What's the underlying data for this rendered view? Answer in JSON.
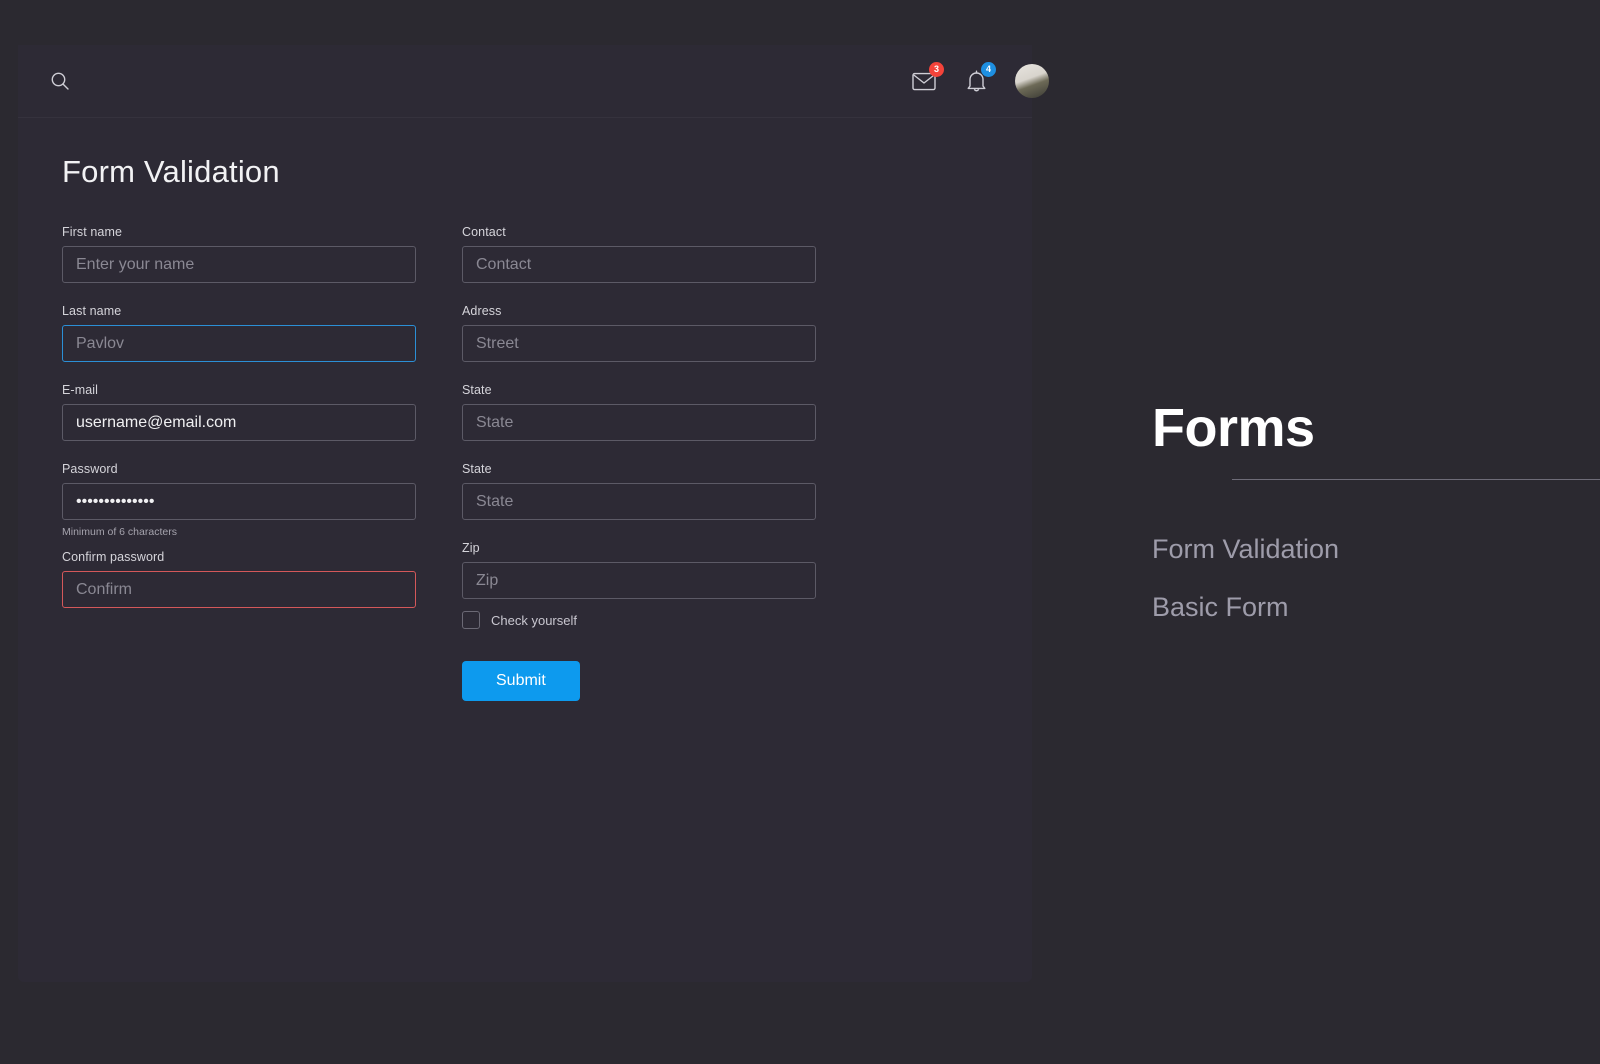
{
  "theme": {
    "page_bg": "#2b2930",
    "panel_bg": "#2d2a35",
    "accent_blue": "#0d9aee",
    "focus_blue": "#2b8fd6",
    "error_red": "#d4585a",
    "badge_red": "#f4433a",
    "badge_blue": "#1e8fe1"
  },
  "header": {
    "search_icon": "search-icon",
    "mail_icon": "mail-icon",
    "mail_badge": "3",
    "bell_icon": "bell-icon",
    "bell_badge": "4",
    "avatar_icon": "avatar"
  },
  "main": {
    "title": "Form Validation",
    "left_fields": [
      {
        "label": "First name",
        "placeholder": "Enter your name",
        "value": "",
        "state": "default",
        "hint": ""
      },
      {
        "label": "Last name",
        "placeholder": "Pavlov",
        "value": "",
        "state": "focused",
        "hint": ""
      },
      {
        "label": "E-mail",
        "placeholder": "",
        "value": "username@email.com",
        "state": "default",
        "hint": ""
      },
      {
        "label": "Password",
        "placeholder": "",
        "value": "••••••••••••••",
        "state": "default",
        "hint": "Minimum of 6 characters"
      },
      {
        "label": "Confirm password",
        "placeholder": "Confirm",
        "value": "",
        "state": "error",
        "hint": ""
      }
    ],
    "right_fields": [
      {
        "label": "Contact",
        "placeholder": "Contact",
        "value": "",
        "state": "default",
        "hint": ""
      },
      {
        "label": "Adress",
        "placeholder": "Street",
        "value": "",
        "state": "default",
        "hint": ""
      },
      {
        "label": "State",
        "placeholder": "State",
        "value": "",
        "state": "default",
        "hint": ""
      },
      {
        "label": "State",
        "placeholder": "State",
        "value": "",
        "state": "default",
        "hint": ""
      },
      {
        "label": "Zip",
        "placeholder": "Zip",
        "value": "",
        "state": "default",
        "hint": ""
      }
    ],
    "checkbox": {
      "label": "Check yourself",
      "checked": false
    },
    "submit_label": "Submit"
  },
  "side_nav": {
    "title": "Forms",
    "links": [
      {
        "label": "Form Validation"
      },
      {
        "label": "Basic Form"
      }
    ]
  }
}
